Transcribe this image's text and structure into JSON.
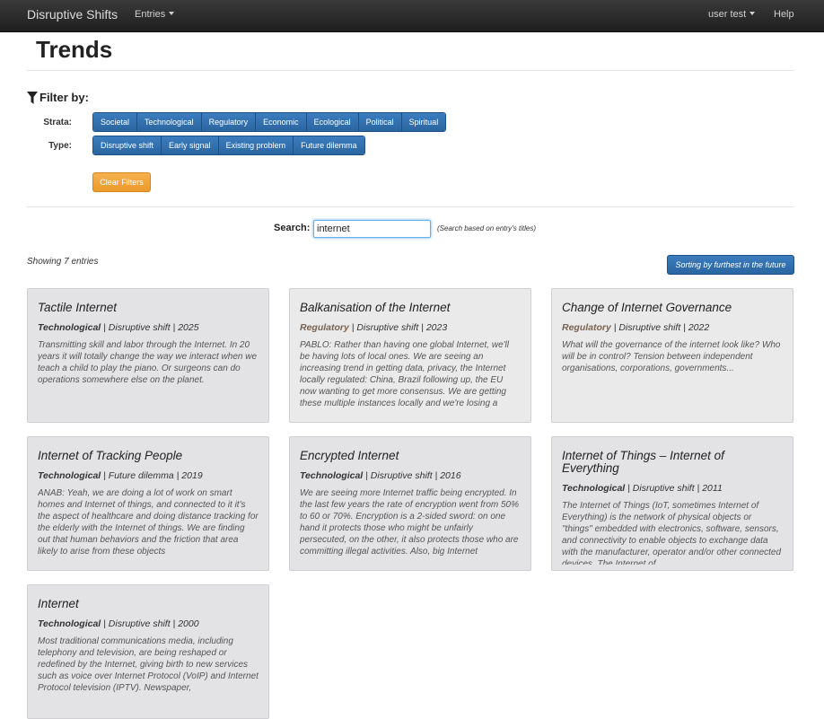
{
  "navbar": {
    "brand": "Disruptive Shifts",
    "entries": "Entries",
    "user": "user test",
    "help": "Help"
  },
  "page": {
    "title": "Trends"
  },
  "filter": {
    "heading": "Filter by:",
    "strata_label": "Strata:",
    "type_label": "Type:",
    "strata": [
      "Societal",
      "Technological",
      "Regulatory",
      "Economic",
      "Ecological",
      "Political",
      "Spiritual"
    ],
    "types": [
      "Disruptive shift",
      "Early signal",
      "Existing problem",
      "Future dilemma"
    ],
    "clear_label": "Clear Filters"
  },
  "search": {
    "label": "Search:",
    "value": "internet",
    "hint": "(Search based on entry's titles)"
  },
  "results": {
    "showing": "Showing 7 entries",
    "sort_label": "Sorting by furthest in the future"
  },
  "entries": [
    {
      "title": "Tactile Internet",
      "strata": "Technological",
      "type": "Disruptive shift",
      "year": "2025",
      "desc": "Transmitting skill and labor through the Internet. In 20 years it will totally change the way we interact when we teach a child to play the piano. Or surgeons can do operations somewhere else on the planet."
    },
    {
      "title": "Balkanisation of the Internet",
      "strata": "Regulatory",
      "type": "Disruptive shift",
      "year": "2023",
      "desc": "PABLO: Rather than having one global Internet, we'll be having lots of local ones. We are seeing an increasing trend in getting data, privacy, the Internet locally regulated: China, Brazil following up, the EU now wanting to get more consensus. We are getting these multiple instances locally and we're losing a"
    },
    {
      "title": "Change of Internet Governance",
      "strata": "Regulatory",
      "type": "Disruptive shift",
      "year": "2022",
      "desc": "What will the governance of the internet look like? Who will be in control? Tension between independent organisations, corporations, governments..."
    },
    {
      "title": "Internet of Tracking People",
      "strata": "Technological",
      "type": "Future dilemma",
      "year": "2019",
      "desc": "ANAB: Yeah, we are doing a lot of work on smart homes and Internet of things, and connected to it it's the aspect of healthcare and doing distance tracking for the elderly with the Internet of things. We are finding out that human behaviors and the friction that area likely to arise from these objects"
    },
    {
      "title": "Encrypted Internet",
      "strata": "Technological",
      "type": "Disruptive shift",
      "year": "2016",
      "desc": "We are seeing more Internet traffic being encrypted. In the last few years the rate of encryption went from 50% to 60 or 70%. Encryption is a 2-sided sword: on one hand it protects those who might be unfairly persecuted, on the other, it also protects those who are committing illegal activities. Also, big Internet"
    },
    {
      "title": "Internet of Things – Internet of Everything",
      "strata": "Technological",
      "type": "Disruptive shift",
      "year": "2011",
      "desc": "The Internet of Things (IoT, sometimes Internet of Everything) is the network of physical objects or \"things\" embedded with electronics, software, sensors, and connectivity to enable objects to exchange data with the manufacturer, operator and/or other connected devices. The Internet of"
    },
    {
      "title": "Internet",
      "strata": "Technological",
      "type": "Disruptive shift",
      "year": "2000",
      "desc": "Most traditional communications media, including telephony and television, are being reshaped or redefined by the Internet, giving birth to new services such as voice over Internet Protocol (VoIP) and Internet Protocol television (IPTV). Newspaper,"
    }
  ]
}
